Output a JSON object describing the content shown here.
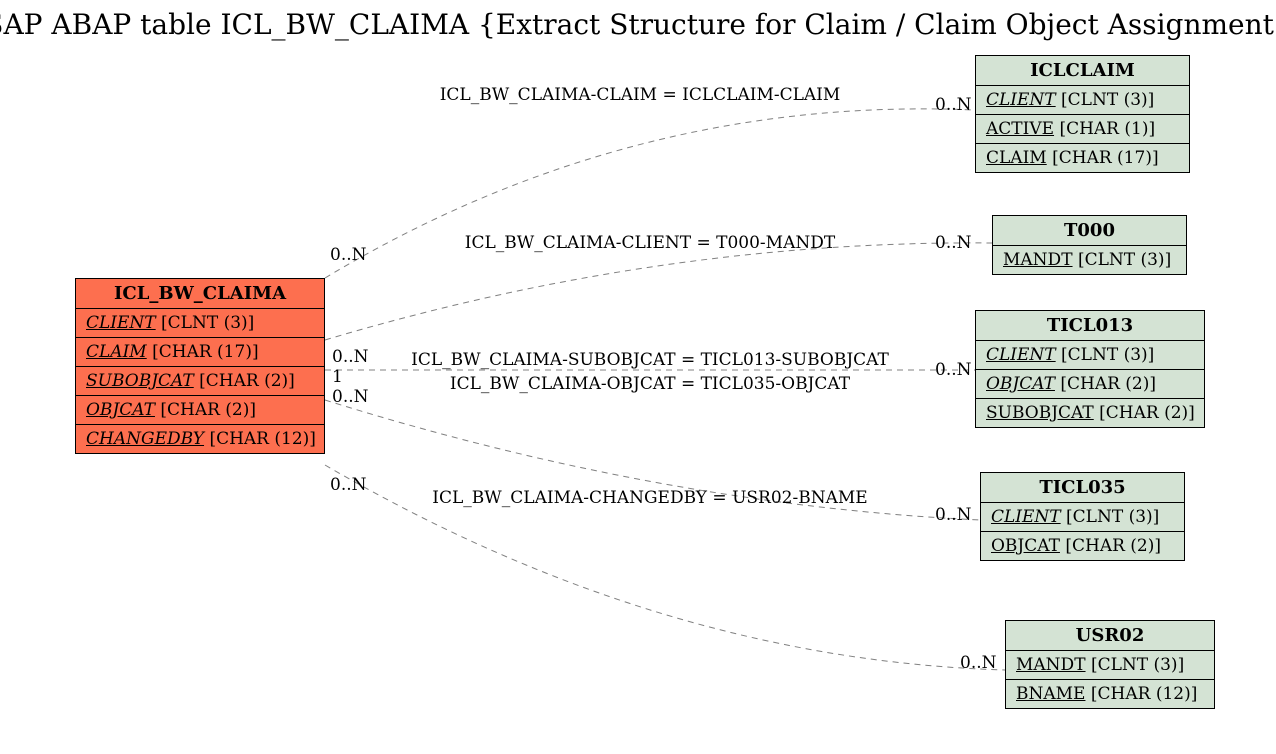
{
  "title": "SAP ABAP table ICL_BW_CLAIMA {Extract Structure for Claim / Claim Object Assignment}",
  "main": {
    "name": "ICL_BW_CLAIMA",
    "fields": [
      {
        "name": "CLIENT",
        "type": "[CLNT (3)]",
        "fk": true
      },
      {
        "name": "CLAIM",
        "type": "[CHAR (17)]",
        "fk": true
      },
      {
        "name": "SUBOBJCAT",
        "type": "[CHAR (2)]",
        "fk": true
      },
      {
        "name": "OBJCAT",
        "type": "[CHAR (2)]",
        "fk": true
      },
      {
        "name": "CHANGEDBY",
        "type": "[CHAR (12)]",
        "fk": true
      }
    ]
  },
  "refs": [
    {
      "name": "ICLCLAIM",
      "fields": [
        {
          "name": "CLIENT",
          "type": "[CLNT (3)]",
          "fk": true
        },
        {
          "name": "ACTIVE",
          "type": "[CHAR (1)]",
          "pk": true
        },
        {
          "name": "CLAIM",
          "type": "[CHAR (17)]",
          "pk": true
        }
      ]
    },
    {
      "name": "T000",
      "fields": [
        {
          "name": "MANDT",
          "type": "[CLNT (3)]",
          "pk": true
        }
      ]
    },
    {
      "name": "TICL013",
      "fields": [
        {
          "name": "CLIENT",
          "type": "[CLNT (3)]",
          "fk": true
        },
        {
          "name": "OBJCAT",
          "type": "[CHAR (2)]",
          "fk": true
        },
        {
          "name": "SUBOBJCAT",
          "type": "[CHAR (2)]",
          "pk": true
        }
      ]
    },
    {
      "name": "TICL035",
      "fields": [
        {
          "name": "CLIENT",
          "type": "[CLNT (3)]",
          "fk": true
        },
        {
          "name": "OBJCAT",
          "type": "[CHAR (2)]",
          "pk": true
        }
      ]
    },
    {
      "name": "USR02",
      "fields": [
        {
          "name": "MANDT",
          "type": "[CLNT (3)]",
          "pk": true
        },
        {
          "name": "BNAME",
          "type": "[CHAR (12)]",
          "pk": true
        }
      ]
    }
  ],
  "edges": [
    {
      "label": "ICL_BW_CLAIMA-CLAIM = ICLCLAIM-CLAIM",
      "lm": "0..N",
      "rm": "0..N"
    },
    {
      "label": "ICL_BW_CLAIMA-CLIENT = T000-MANDT",
      "lm": "0..N",
      "rm": "0..N"
    },
    {
      "label": "ICL_BW_CLAIMA-SUBOBJCAT = TICL013-SUBOBJCAT",
      "lm": "1",
      "rm": "0..N"
    },
    {
      "label": "ICL_BW_CLAIMA-OBJCAT = TICL035-OBJCAT",
      "lm": "0..N",
      "rm": "0..N"
    },
    {
      "label": "ICL_BW_CLAIMA-CHANGEDBY = USR02-BNAME",
      "lm": "0..N",
      "rm": "0..N"
    }
  ]
}
